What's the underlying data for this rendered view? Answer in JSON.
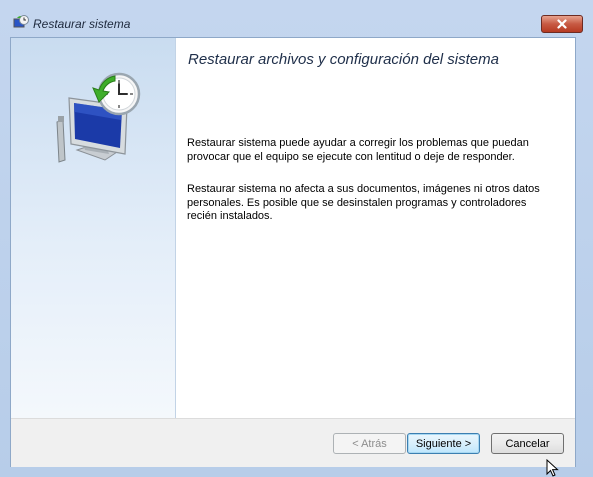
{
  "window": {
    "title": "Restaurar sistema",
    "close_icon": "close-icon",
    "app_icon": "system-restore-icon"
  },
  "main": {
    "heading": "Restaurar archivos y configuración del sistema",
    "paragraph1": "Restaurar sistema puede ayudar a corregir los problemas que puedan provocar que el equipo se ejecute con lentitud o deje de responder.",
    "paragraph2": "Restaurar sistema no afecta a sus documentos, imágenes ni otros datos personales. Es posible que se desinstalen programas y controladores recién instalados.",
    "hero_icon": "computer-clock-restore-icon"
  },
  "buttons": {
    "back_label": "< Atrás",
    "next_label": "Siguiente >",
    "cancel_label": "Cancelar"
  },
  "colors": {
    "close_button": "#c75a43",
    "accent_arrow": "#3fae2a",
    "monitor_screen": "#1b3aa8"
  }
}
